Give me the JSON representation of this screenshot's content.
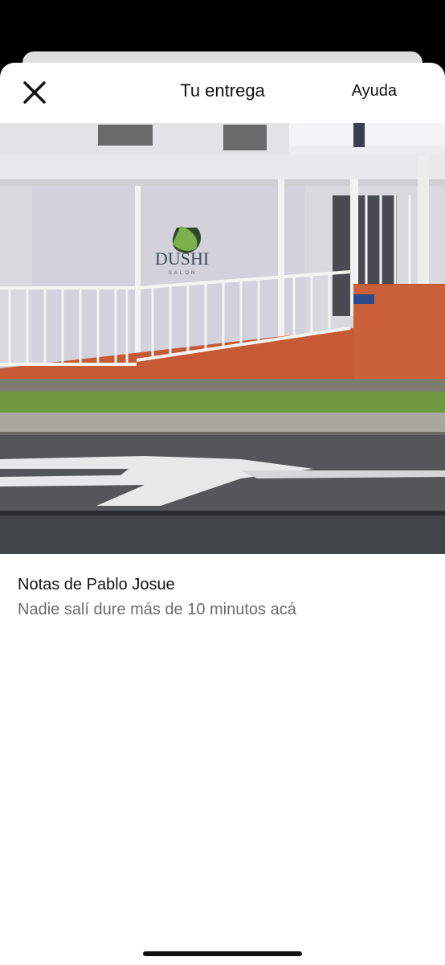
{
  "header": {
    "title": "Tu entrega",
    "help_label": "Ayuda",
    "close_icon": "close-icon"
  },
  "photo": {
    "sign_text": "DUSHI",
    "sign_subtext": "SALON"
  },
  "notes": {
    "title": "Notas de Pablo Josue",
    "body": "Nadie salí dure más de 10 minutos acá"
  },
  "colors": {
    "wall": "#d9d8df",
    "orange_wall": "#c65a35",
    "grass": "#6f9a3f",
    "road": "#55565a"
  }
}
